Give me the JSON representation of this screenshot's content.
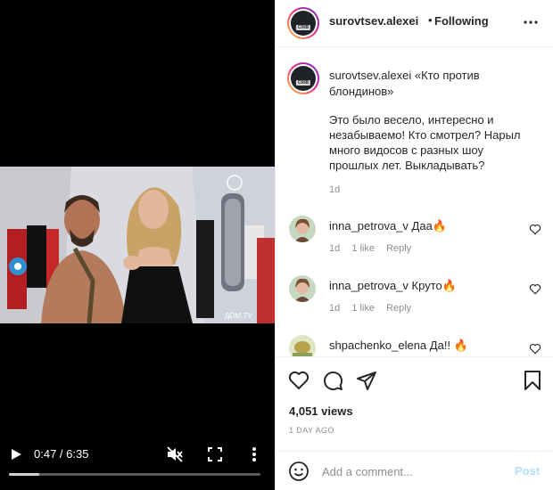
{
  "video": {
    "time": "0:47 / 6:35",
    "progress": 0.119,
    "watermark": "ДОМ.TV",
    "icons": {
      "play": "play-icon",
      "mute": "muted-speaker-icon",
      "fullscreen": "fullscreen-icon",
      "more": "vertical-dots-icon"
    }
  },
  "header": {
    "username": "surovtsev.alexei",
    "separator": "•",
    "follow_status": "Following",
    "avatar_tag": "CRIB",
    "more_icon": "horizontal-dots-icon"
  },
  "caption": {
    "username": "surovtsev.alexei",
    "title": "«Кто против блондинов»",
    "body": "Это было весело, интересно и незабываемо! Кто смотрел? Нарыл много видосов с разных шоу прошлых лет. Выкладывать?",
    "time": "1d"
  },
  "comments": [
    {
      "username": "inna_petrova_v",
      "text": "Даа🔥",
      "time": "1d",
      "likes": "1 like",
      "reply": "Reply"
    },
    {
      "username": "inna_petrova_v",
      "text": "Круто🔥",
      "time": "1d",
      "likes": "1 like",
      "reply": "Reply"
    },
    {
      "username": "shpachenko_elena",
      "text": "Да!! 🔥",
      "time": "",
      "likes": "",
      "reply": ""
    }
  ],
  "actions": {
    "icons": [
      "heart-icon",
      "comment-bubble-icon",
      "share-paper-plane-icon",
      "bookmark-icon"
    ],
    "views": "4,051 views",
    "date": "1 DAY AGO"
  },
  "add_comment": {
    "placeholder": "Add a comment...",
    "post_label": "Post",
    "emoji_icon": "smiley-face-icon"
  },
  "colors": {
    "post_disabled": "#b2dffc",
    "muted_text": "#8e8e8e",
    "primary_text": "#262626"
  }
}
